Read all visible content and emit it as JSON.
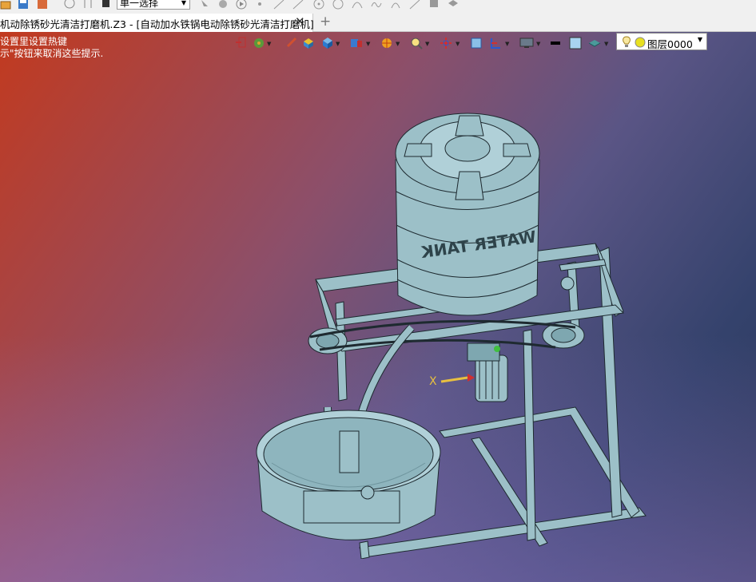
{
  "toolbar": {
    "mode_select": "单一选择"
  },
  "tabs": {
    "doc_title": "机动除锈砂光清洁打磨机.Z3 - [自动加水铁锅电动除锈砂光清洁打磨机]",
    "close_glyph": "✕",
    "new_tab_glyph": "+"
  },
  "viewport": {
    "hint_line1": "设置里设置热键",
    "hint_line2": "示\"按钮来取消这些提示.",
    "layer": "图层0000",
    "axis_x": "X",
    "tank_text": "WATER TANK"
  },
  "colors": {
    "part": "#9cc0c8",
    "part_dark": "#6f959e",
    "edge": "#1e2a30"
  }
}
